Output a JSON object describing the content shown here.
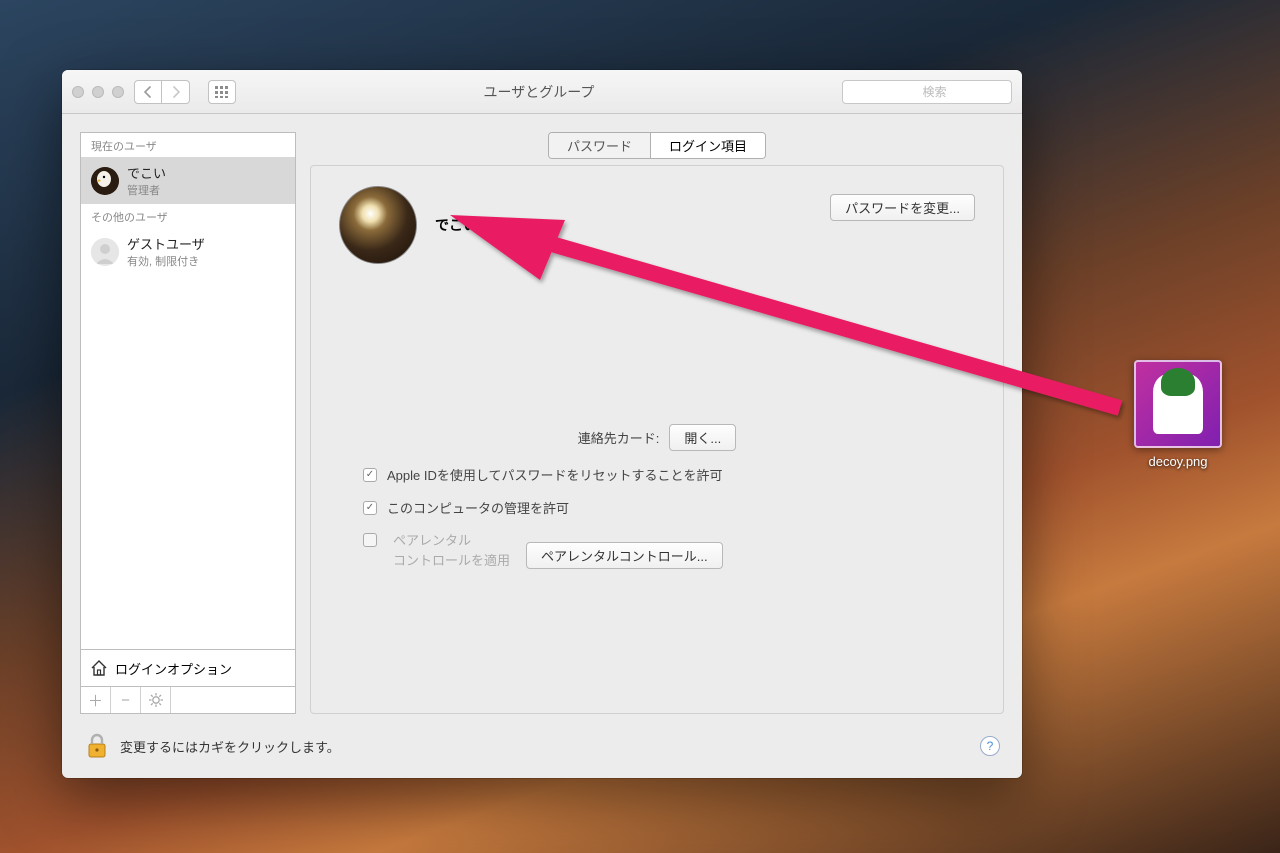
{
  "titlebar": {
    "title": "ユーザとグループ",
    "search_placeholder": "検索"
  },
  "sidebar": {
    "current_header": "現在のユーザ",
    "other_header": "その他のユーザ",
    "users": [
      {
        "name": "でこい",
        "role": "管理者",
        "selected": true,
        "avatar": "eagle"
      },
      {
        "name": "ゲストユーザ",
        "role": "有効, 制限付き",
        "selected": false,
        "avatar": "guest"
      }
    ],
    "login_options": "ログインオプション"
  },
  "tabs": {
    "password": "パスワード",
    "login_items": "ログイン項目"
  },
  "panel": {
    "username": "でこい",
    "change_password_btn": "パスワードを変更...",
    "contact_card_label": "連絡先カード:",
    "open_btn": "開く...",
    "allow_appleid_reset": "Apple IDを使用してパスワードをリセットすることを許可",
    "allow_admin": "このコンピュータの管理を許可",
    "parental_label_1": "ペアレンタル",
    "parental_label_2": "コントロールを適用",
    "parental_btn": "ペアレンタルコントロール..."
  },
  "footer": {
    "lock_text": "変更するにはカギをクリックします。"
  },
  "desktop": {
    "filename": "decoy.png"
  }
}
